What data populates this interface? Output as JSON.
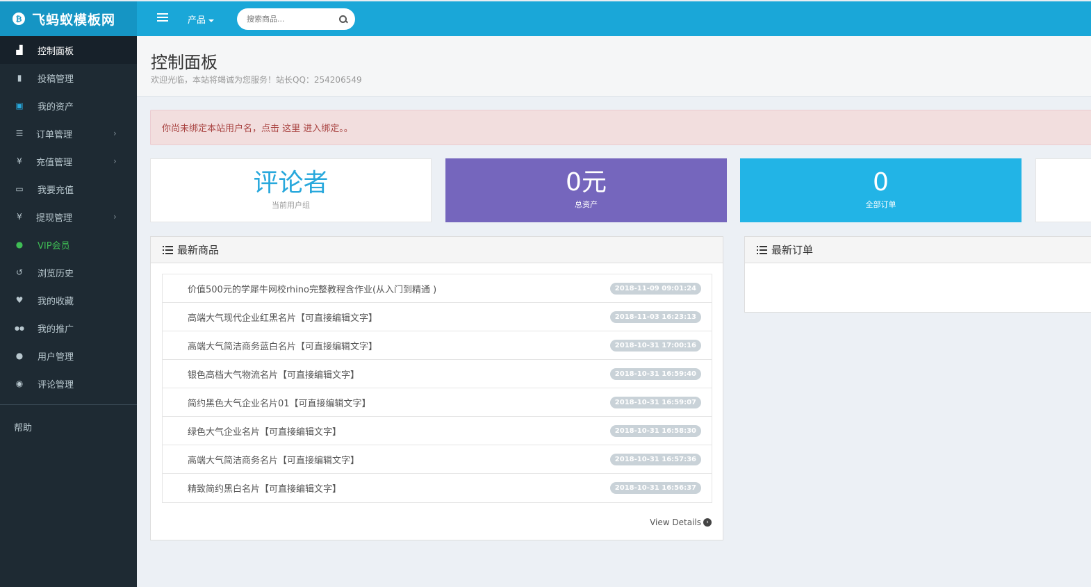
{
  "brand": {
    "name": "飞蚂蚁模板网",
    "badge": "₿"
  },
  "topnav": {
    "product_label": "产品",
    "search_placeholder": "搜索商品..."
  },
  "sidebar": {
    "items": [
      {
        "label": "控制面板",
        "icon": "bar-chart-icon",
        "glyph": "▟"
      },
      {
        "label": "投稿管理",
        "icon": "file-icon",
        "glyph": "▮"
      },
      {
        "label": "我的资产",
        "icon": "money-icon",
        "glyph": "▣"
      },
      {
        "label": "订单管理",
        "icon": "list-icon",
        "glyph": "☰",
        "chevron": "›"
      },
      {
        "label": "充值管理",
        "icon": "yen-icon",
        "glyph": "¥",
        "chevron": "›"
      },
      {
        "label": "我要充值",
        "icon": "credit-card-icon",
        "glyph": "▭"
      },
      {
        "label": "提现管理",
        "icon": "yen-icon",
        "glyph": "¥",
        "chevron": "›"
      },
      {
        "label": "VIP会员",
        "icon": "user-icon",
        "glyph": "●"
      },
      {
        "label": "浏览历史",
        "icon": "history-icon",
        "glyph": "↺"
      },
      {
        "label": "我的收藏",
        "icon": "heart-icon",
        "glyph": "♥"
      },
      {
        "label": "我的推广",
        "icon": "users-icon",
        "glyph": "●●"
      },
      {
        "label": "用户管理",
        "icon": "user-icon",
        "glyph": "●"
      },
      {
        "label": "评论管理",
        "icon": "comment-icon",
        "glyph": "◉"
      }
    ],
    "help_label": "帮助"
  },
  "header": {
    "title": "控制面板",
    "subtitle": "欢迎光临，本站将竭诚为您服务！站长QQ：254206549"
  },
  "alert": {
    "text_before": "你尚未绑定本站用户名，点击 ",
    "link": "这里",
    "text_after": " 进入绑定。。"
  },
  "stats": [
    {
      "value": "评论者",
      "label": "当前用户组"
    },
    {
      "value": "0元",
      "label": "总资产"
    },
    {
      "value": "0",
      "label": "全部订单"
    }
  ],
  "goods_panel": {
    "title": "最新商品",
    "items": [
      {
        "title": "价值500元的学犀牛网校rhino完整教程含作业(从入门到精通 )",
        "time": "2018-11-09 09:01:24"
      },
      {
        "title": "高端大气现代企业红黑名片【可直接编辑文字】",
        "time": "2018-11-03 16:23:13"
      },
      {
        "title": "高端大气简洁商务蓝白名片【可直接编辑文字】",
        "time": "2018-10-31 17:00:16"
      },
      {
        "title": "银色高档大气物流名片【可直接编辑文字】",
        "time": "2018-10-31 16:59:40"
      },
      {
        "title": "简约黑色大气企业名片01【可直接编辑文字】",
        "time": "2018-10-31 16:59:07"
      },
      {
        "title": "绿色大气企业名片【可直接编辑文字】",
        "time": "2018-10-31 16:58:30"
      },
      {
        "title": "高端大气简洁商务名片【可直接编辑文字】",
        "time": "2018-10-31 16:57:36"
      },
      {
        "title": "精致简约黑白名片【可直接编辑文字】",
        "time": "2018-10-31 16:56:37"
      }
    ],
    "view_details": "View Details"
  },
  "orders_panel": {
    "title": "最新订单"
  },
  "colors": {
    "topbar": "#1aa7d8",
    "sidebar": "#1e2a33",
    "stat_purple": "#7566bd",
    "stat_blue": "#22b4e6",
    "vip_green": "#3fbd55"
  }
}
